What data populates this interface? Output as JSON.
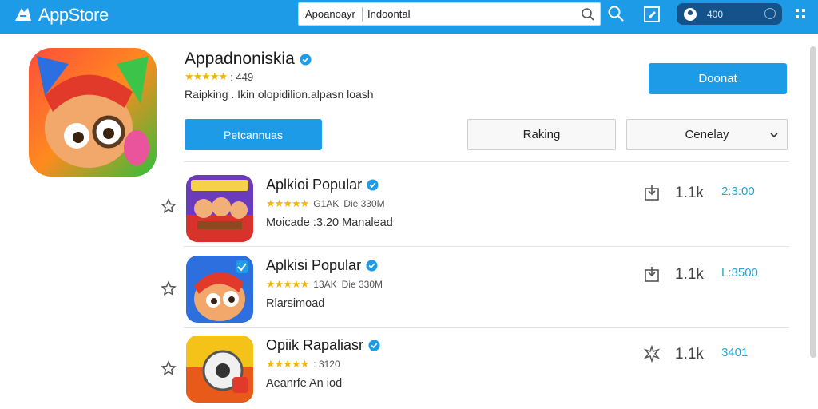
{
  "topbar": {
    "brand": "AppStore",
    "search_scope": "Apoanoayr",
    "search_value": "Indoontal",
    "account_label": "400",
    "color": "#1e9be6"
  },
  "hero": {
    "title": "Appadnoniskia",
    "rating": ": 449",
    "stars": "★★★★★",
    "description": "Raipking . Ikin olopidilion.alpasn loash",
    "primary_button": "Doonat",
    "tab_button": "Petcannuas",
    "sort_button": "Raking",
    "filter_select": "Cenelay"
  },
  "rows": [
    {
      "title": "Aplkioi Popular",
      "stars": "★★★★★",
      "meta_a": "G1AK",
      "meta_b": "Die  330M",
      "sub": "Moicade :3.20  Manalead",
      "count": "1.1k",
      "value": "2:3:00"
    },
    {
      "title": "Aplkisi Popular",
      "stars": "★★★★★",
      "meta_a": "13AK",
      "meta_b": "Die  330M",
      "sub": "Rlarsimoad",
      "count": "1.1k",
      "value": "L:3500"
    },
    {
      "title": "Opiik Rapaliasr",
      "stars": "★★★★★",
      "meta_a": ": 3120",
      "meta_b": "",
      "sub": "Aeanrfe An  iod",
      "count": "1.1k",
      "value": "3401"
    }
  ],
  "icons": {
    "brand": "app-store-logo-icon",
    "search": "search-icon",
    "edit": "edit-icon",
    "apps": "grid-icon",
    "favorite": "star-outline-icon",
    "download": "download-icon",
    "verified": "verified-badge-icon"
  },
  "accent": "#1e9be6",
  "star_color": "#f2b705",
  "value_color": "#26a5d6"
}
